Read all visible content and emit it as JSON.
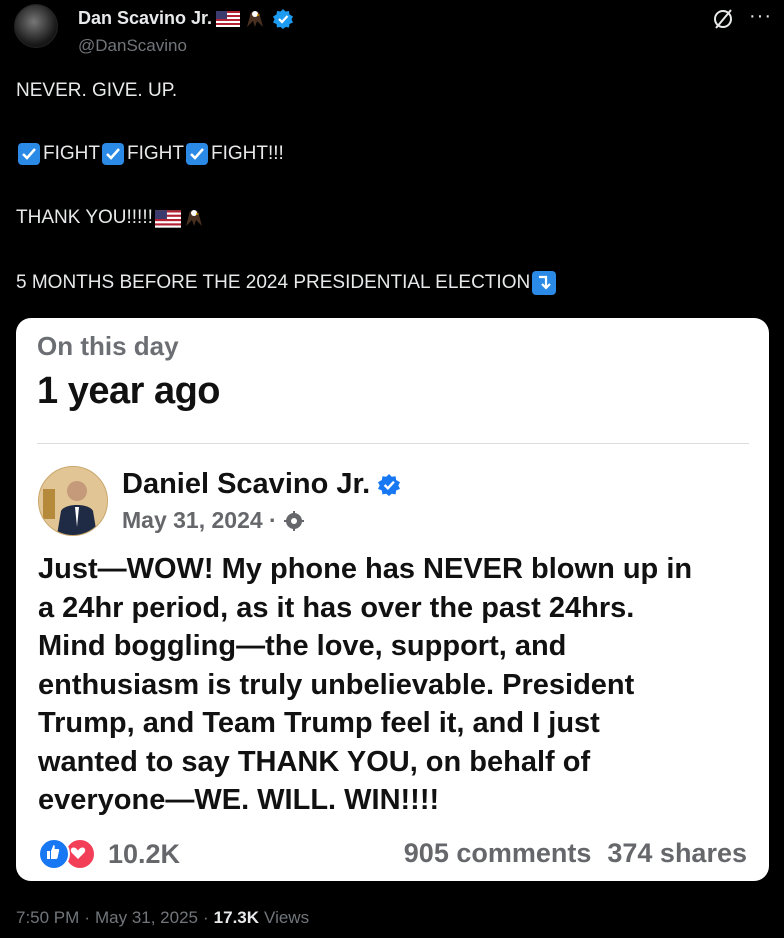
{
  "author": {
    "display_name": "Dan Scavino Jr.",
    "handle": "@DanScavino",
    "verified": true
  },
  "tweet": {
    "line1": "NEVER. GIVE. UP.",
    "fight_words": [
      "FIGHT",
      "FIGHT",
      "FIGHT!!!"
    ],
    "line3": "THANK YOU!!!!!",
    "line4": "5 MONTHS BEFORE THE 2024 PRESIDENTIAL ELECTION"
  },
  "memory_card": {
    "kicker": "On this day",
    "title": "1 year ago",
    "post": {
      "author": "Daniel Scavino Jr.",
      "date": "May 31, 2024 ·",
      "body_lines": [
        "Just—WOW! My phone has NEVER blown up in",
        "a 24hr period, as it has over the past 24hrs.",
        "Mind boggling—the love, support, and",
        "enthusiasm is truly unbelievable. President",
        "Trump, and Team Trump feel it, and I just",
        "wanted to say THANK YOU, on behalf of",
        "everyone—WE. WILL. WIN!!!!"
      ],
      "reaction_count": "10.2K",
      "comments": "905 comments",
      "shares": "374 shares"
    }
  },
  "footer": {
    "time": "7:50 PM",
    "sep1": "·",
    "date": "May 31, 2025",
    "sep2": "·",
    "views_count": "17.3K",
    "views_label": "Views"
  },
  "colors": {
    "background": "#000000",
    "text": "#e7e9ea",
    "muted": "#71767b",
    "verified_blue": "#1d9bf0",
    "check_blue": "#2b8ae6",
    "fb_like": "#1877f2",
    "fb_love": "#f33e58"
  },
  "icons": [
    "grok-icon",
    "more-icon",
    "verified-icon",
    "flag-icon",
    "eagle-icon",
    "check-mark-icon",
    "arrow-down-icon",
    "globe-icon",
    "like-icon",
    "love-icon"
  ]
}
